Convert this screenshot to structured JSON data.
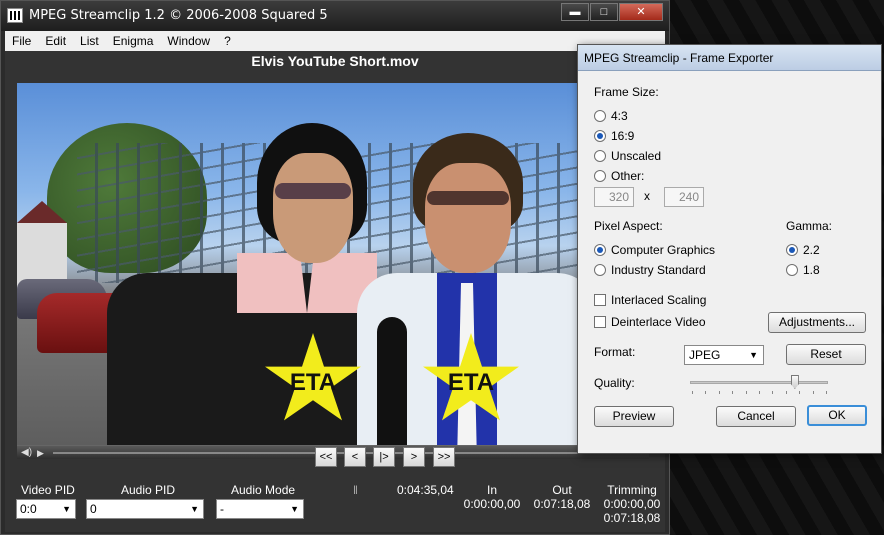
{
  "main_window": {
    "title": "MPEG Streamclip 1.2  ©  2006-2008 Squared 5",
    "controls": {
      "minimize": "▬",
      "maximize": "□",
      "close": "✕"
    },
    "menu": [
      "File",
      "Edit",
      "List",
      "Enigma",
      "Window",
      "?"
    ],
    "file_title": "Elvis YouTube Short.mov",
    "video": {
      "overlay_labels": [
        "ETA",
        "ETA"
      ],
      "playhead_fraction": 0.663
    },
    "bottom": {
      "video_pid_label": "Video PID",
      "video_pid_value": "0:0",
      "audio_pid_label": "Audio PID",
      "audio_pid_value": "0",
      "audio_mode_label": "Audio Mode",
      "audio_mode_value": "-",
      "marker": "‖",
      "current_time": "0:04:35,04",
      "nav_buttons": [
        "<<",
        "<",
        "|>",
        ">",
        ">>"
      ],
      "in_label": "In",
      "in_value": "0:00:00,00",
      "out_label": "Out",
      "out_value": "0:07:18,08",
      "trimming_label": "Trimming",
      "trimming_value1": "0:00:00,00",
      "trimming_value2": "0:07:18,08"
    }
  },
  "frame_exporter": {
    "title": "MPEG Streamclip - Frame Exporter",
    "frame_size_label": "Frame Size:",
    "frame_sizes": [
      {
        "label": "4:3",
        "checked": false
      },
      {
        "label": "16:9",
        "checked": true
      },
      {
        "label": "Unscaled",
        "checked": false
      },
      {
        "label": "Other:",
        "checked": false
      }
    ],
    "other_width": "320",
    "other_x": "x",
    "other_height": "240",
    "pixel_aspect_label": "Pixel Aspect:",
    "pixel_aspects": [
      {
        "label": "Computer Graphics",
        "checked": true
      },
      {
        "label": "Industry Standard",
        "checked": false
      }
    ],
    "gamma_label": "Gamma:",
    "gammas": [
      {
        "label": "2.2",
        "checked": true
      },
      {
        "label": "1.8",
        "checked": false
      }
    ],
    "interlaced_scaling_label": "Interlaced Scaling",
    "interlaced_scaling_checked": false,
    "deinterlace_label": "Deinterlace Video",
    "deinterlace_checked": false,
    "adjustments_button": "Adjustments...",
    "format_label": "Format:",
    "format_value": "JPEG",
    "reset_button": "Reset",
    "quality_label": "Quality:",
    "quality_fraction": 0.76,
    "preview_button": "Preview",
    "cancel_button": "Cancel",
    "ok_button": "OK"
  }
}
